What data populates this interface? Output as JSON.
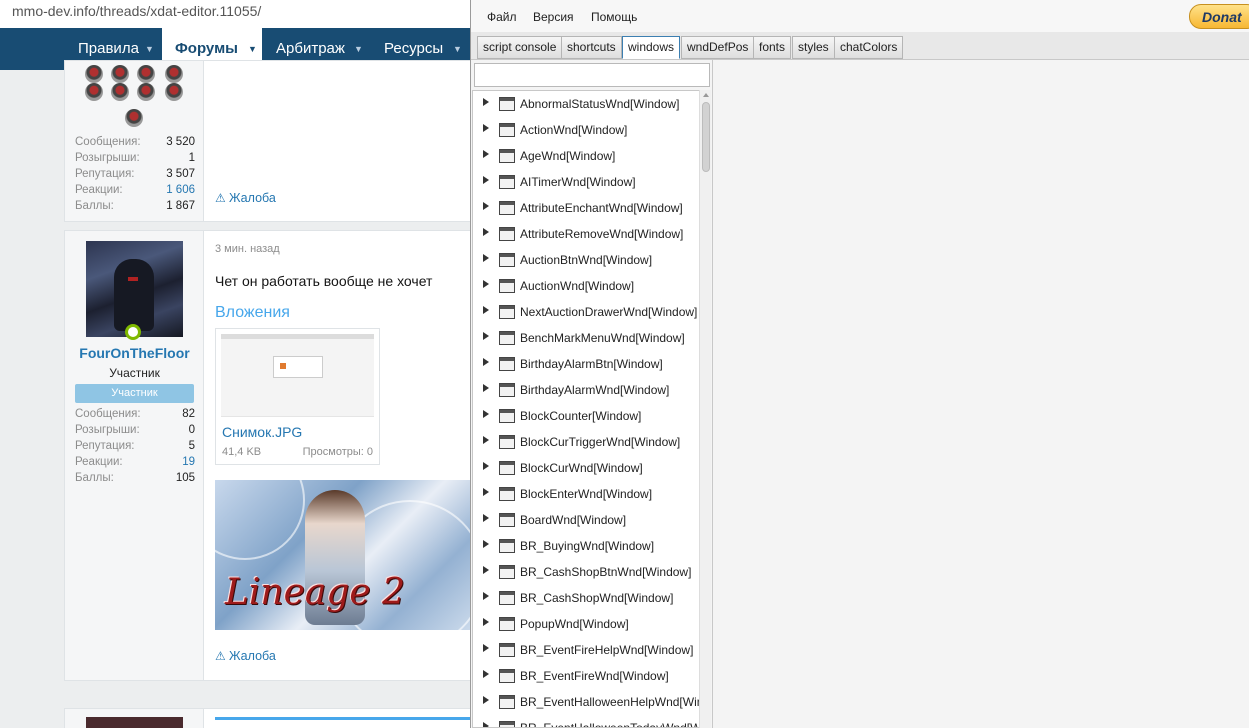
{
  "browser": {
    "url": "mmo-dev.info/threads/xdat-editor.11055/"
  },
  "nav": {
    "items": [
      {
        "label": "Правила",
        "active": false
      },
      {
        "label": "Форумы",
        "active": true
      },
      {
        "label": "Арбитраж",
        "active": false
      },
      {
        "label": "Ресурсы",
        "active": false
      }
    ]
  },
  "post1": {
    "stats": [
      {
        "label": "Сообщения:",
        "value": "3 520"
      },
      {
        "label": "Розыгрыши:",
        "value": "1"
      },
      {
        "label": "Репутация:",
        "value": "3 507"
      },
      {
        "label": "Реакции:",
        "value": "1 606"
      },
      {
        "label": "Баллы:",
        "value": "1 867"
      }
    ],
    "report": "Жалоба"
  },
  "post2": {
    "time": "3 мин. назад",
    "username": "FourOnTheFloor",
    "user_title": "Участник",
    "user_badge": "Участник",
    "text": "Чет он работать вообще не хочет",
    "attachments_title": "Вложения",
    "attachment": {
      "name": "Снимок.JPG",
      "size": "41,4 KB",
      "views": "Просмотры: 0"
    },
    "banner_text": "Lineage 2",
    "stats": [
      {
        "label": "Сообщения:",
        "value": "82"
      },
      {
        "label": "Розыгрыши:",
        "value": "0"
      },
      {
        "label": "Репутация:",
        "value": "5"
      },
      {
        "label": "Реакции:",
        "value": "19"
      },
      {
        "label": "Баллы:",
        "value": "105"
      }
    ],
    "report": "Жалоба"
  },
  "editor": {
    "menu": [
      "Файл",
      "Версия",
      "Помощь"
    ],
    "donate": "Donat",
    "tabs": [
      "script console",
      "shortcuts",
      "windows",
      "wndDefPos",
      "fonts",
      "styles",
      "chatColors"
    ],
    "active_tab": "windows",
    "search_value": "",
    "tree_items": [
      "AbnormalStatusWnd[Window]",
      "ActionWnd[Window]",
      "AgeWnd[Window]",
      "AITimerWnd[Window]",
      "AttributeEnchantWnd[Window]",
      "AttributeRemoveWnd[Window]",
      "AuctionBtnWnd[Window]",
      "AuctionWnd[Window]",
      "NextAuctionDrawerWnd[Window]",
      "BenchMarkMenuWnd[Window]",
      "BirthdayAlarmBtn[Window]",
      "BirthdayAlarmWnd[Window]",
      "BlockCounter[Window]",
      "BlockCurTriggerWnd[Window]",
      "BlockCurWnd[Window]",
      "BlockEnterWnd[Window]",
      "BoardWnd[Window]",
      "BR_BuyingWnd[Window]",
      "BR_CashShopBtnWnd[Window]",
      "BR_CashShopWnd[Window]",
      "PopupWnd[Window]",
      "BR_EventFireHelpWnd[Window]",
      "BR_EventFireWnd[Window]",
      "BR_EventHalloweenHelpWnd[Window]",
      "BR_EventHalloweenTodayWnd[Window]"
    ]
  }
}
